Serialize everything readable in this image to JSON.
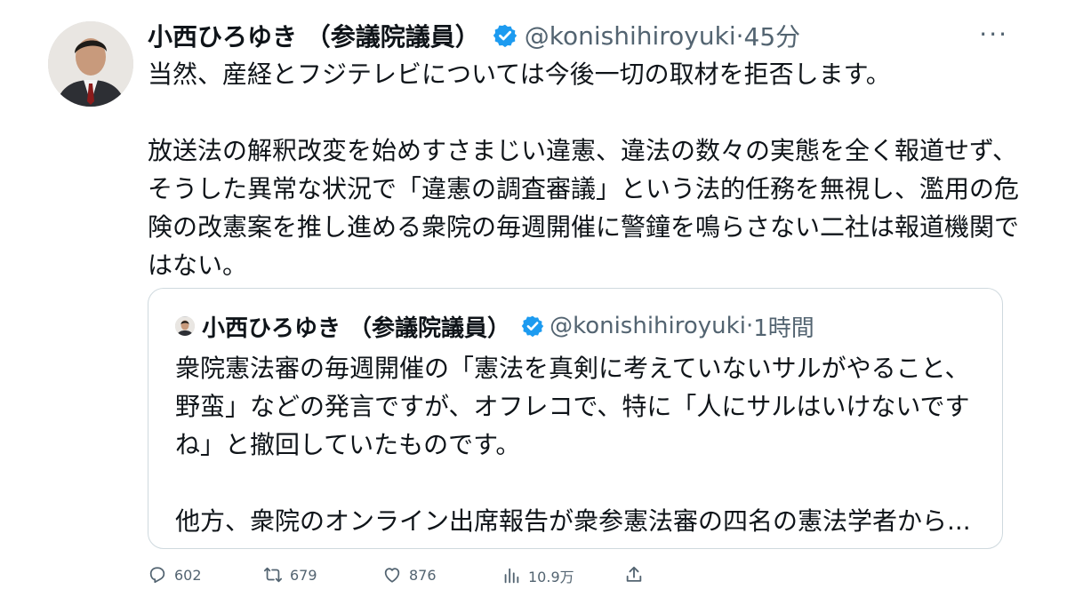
{
  "tweet": {
    "author_name": "小西ひろゆき （参議院議員）",
    "handle": "@konishihiroyuki",
    "separator": "·",
    "time": "45分",
    "more_label": "···",
    "text": "当然、産経とフジテレビについては今後一切の取材を拒否します。\n\n放送法の解釈改変を始めすさまじい違憲、違法の数々の実態を全く報道せず、そうした異常な状況で「違憲の調査審議」という法的任務を無視し、濫用の危険の改憲案を推し進める衆院の毎週開催に警鐘を鳴らさない二社は報道機関ではない。"
  },
  "quoted": {
    "author_name": "小西ひろゆき （参議院議員）",
    "handle": "@konishihiroyuki",
    "separator": "·",
    "time": "1時間",
    "text": "衆院憲法審の毎週開催の「憲法を真剣に考えていないサルがやること、野蛮」などの発言ですが、オフレコで、特に「人にサルはいけないですね」と撤回していたものです。\n\n他方、衆院のオンライン出席報告が衆参憲法審の四名の憲法学者から..."
  },
  "actions": {
    "reply_count": "602",
    "retweet_count": "679",
    "like_count": "876",
    "views_count": "10.9万"
  },
  "colors": {
    "verified": "#1d9bf0",
    "secondary_text": "#536471",
    "border": "#cfd9de"
  },
  "icons": [
    "verified-badge-icon",
    "more-icon",
    "reply-icon",
    "retweet-icon",
    "like-icon",
    "views-icon",
    "share-icon"
  ]
}
